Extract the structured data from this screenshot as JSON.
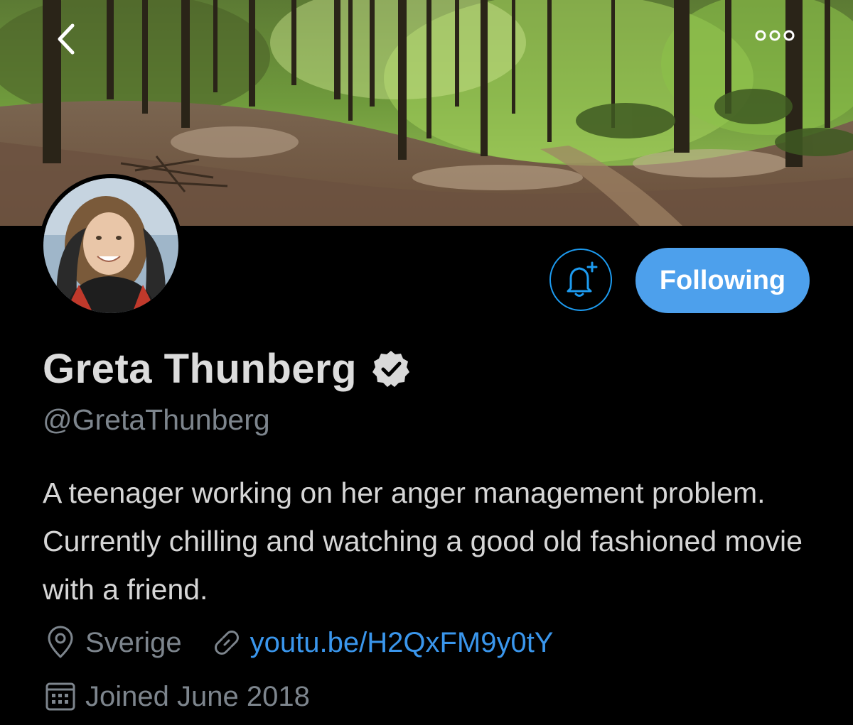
{
  "header": {
    "back_icon": "chevron-left-icon",
    "more_icon": "more-horizontal-icon"
  },
  "banner": {
    "description_icon": "forest-banner-image"
  },
  "profile": {
    "name": "Greta Thunberg",
    "verified": true,
    "handle": "@GretaThunberg",
    "bio": "A teenager working on her anger management problem. Currently chilling and watching a good old fashioned movie with a friend.",
    "location": "Sverige",
    "link": "youtu.be/H2QxFM9y0tY",
    "joined": "Joined June 2018"
  },
  "actions": {
    "notify_icon": "bell-plus-icon",
    "follow_label": "Following"
  },
  "colors": {
    "accent": "#4da0ec",
    "link": "#3a96ec",
    "muted": "#7d858d",
    "background": "#000000"
  }
}
